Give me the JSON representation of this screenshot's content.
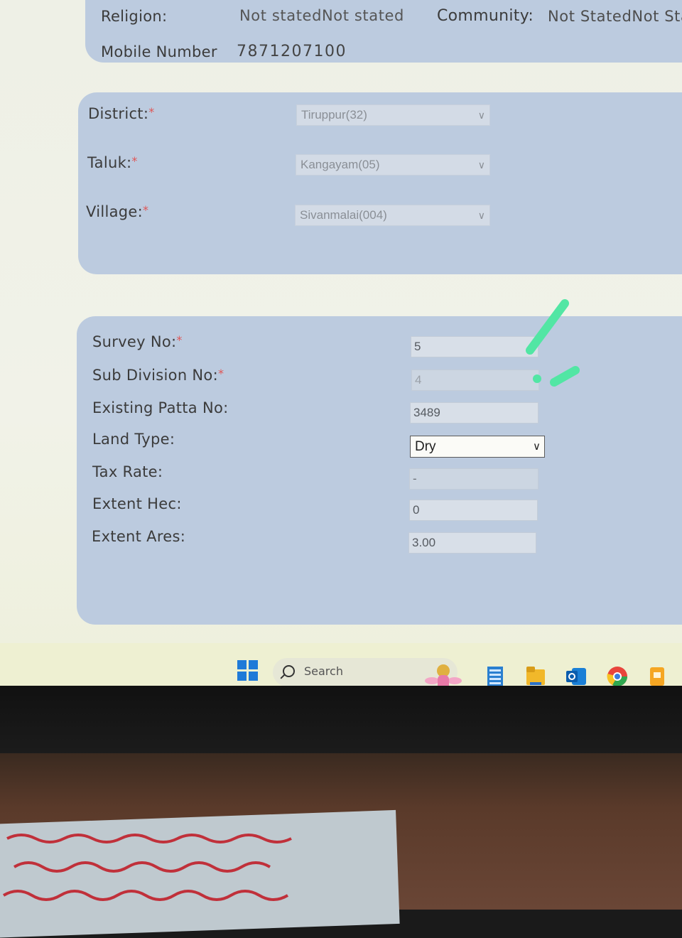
{
  "personal": {
    "religion_label": "Religion:",
    "religion_value": "Not statedNot stated",
    "community_label": "Community:",
    "community_value": "Not StatedNot Sta",
    "mobile_label": "Mobile Number",
    "mobile_value": "7871207100"
  },
  "location": {
    "district_label": "District:",
    "district_value": "Tiruppur(32)",
    "taluk_label": "Taluk:",
    "taluk_value": "Kangayam(05)",
    "village_label": "Village:",
    "village_value": "Sivanmalai(004)",
    "required_mark": "*"
  },
  "land": {
    "survey_no_label": "Survey No:",
    "survey_no_value": "5",
    "sub_division_label": "Sub Division No:",
    "sub_division_value": "4",
    "existing_patta_label": "Existing Patta No:",
    "existing_patta_value": "3489",
    "land_type_label": "Land Type:",
    "land_type_value": "Dry",
    "tax_rate_label": "Tax Rate:",
    "tax_rate_value": "-",
    "extent_hec_label": "Extent Hec:",
    "extent_hec_value": "0",
    "extent_ares_label": "Extent Ares:",
    "extent_ares_value": "3.00",
    "required_mark": "*"
  },
  "taskbar": {
    "search_placeholder": "Search",
    "icons": [
      "windows-start-icon",
      "search-icon",
      "deity-widget-icon",
      "notepad-icon",
      "file-explorer-icon",
      "outlook-icon",
      "chrome-icon",
      "files-icon"
    ]
  },
  "colors": {
    "panel": "#bccbdf",
    "screen_bg": "#eef0e6",
    "required": "#e05555",
    "highlight_marks": "#52e6a4"
  }
}
